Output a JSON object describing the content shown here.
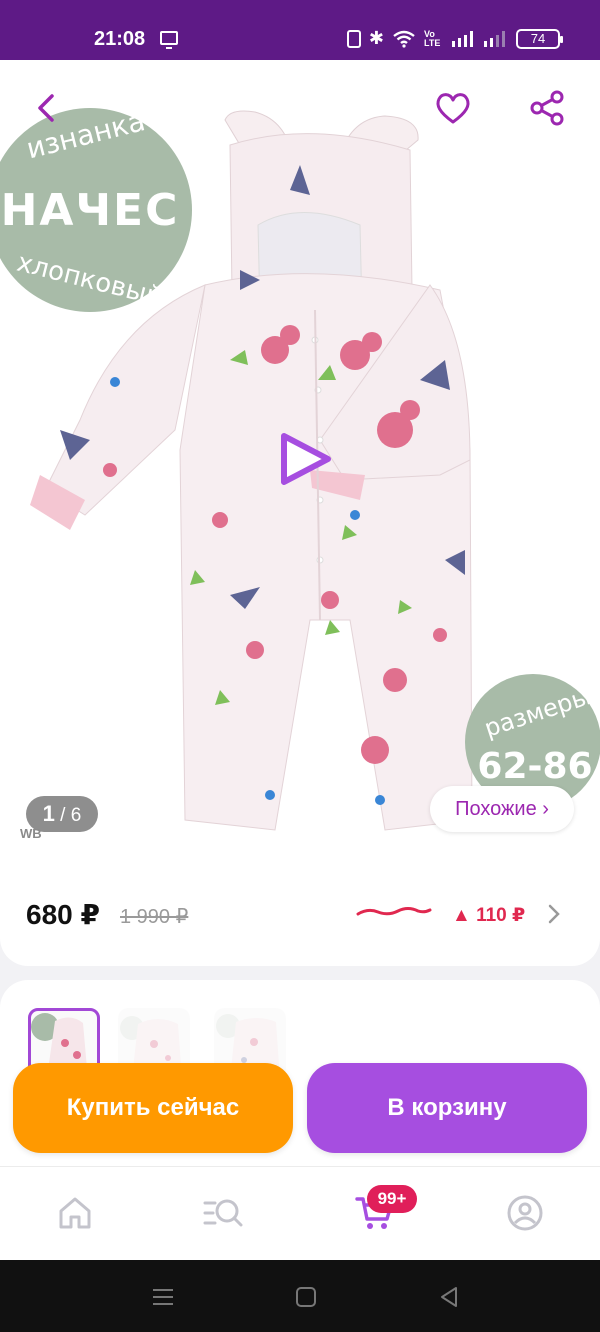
{
  "status_bar": {
    "time": "21:08",
    "battery": "74",
    "volte": "Vo LTE"
  },
  "product": {
    "badges": {
      "top_left_arc_top": "изнанка",
      "top_left_main": "НАЧЕС",
      "top_left_arc_bottom": "хлопковый",
      "sizes_label": "размеры",
      "sizes_range": "62-86"
    },
    "gallery_counter_current": "1",
    "gallery_counter_sep": " / ",
    "gallery_counter_total": "6",
    "watermark": "WB",
    "similar_label": "Похожие ›"
  },
  "price": {
    "current": "680 ₽",
    "old": "1 990 ₽",
    "change": "▲ 110 ₽"
  },
  "actions": {
    "buy_now": "Купить сейчас",
    "add_to_cart": "В корзину"
  },
  "nav": {
    "cart_badge": "99+"
  },
  "colors": {
    "brand_purple": "#a64ee0",
    "status_bar": "#5e1a86",
    "buy_orange": "#ff9900",
    "price_up_red": "#e0284f",
    "badge_green": "#a8bba8"
  },
  "icons": [
    "back-icon",
    "heart-icon",
    "share-icon",
    "play-icon",
    "chevron-right-icon",
    "home-icon",
    "catalog-search-icon",
    "cart-icon",
    "profile-icon"
  ]
}
